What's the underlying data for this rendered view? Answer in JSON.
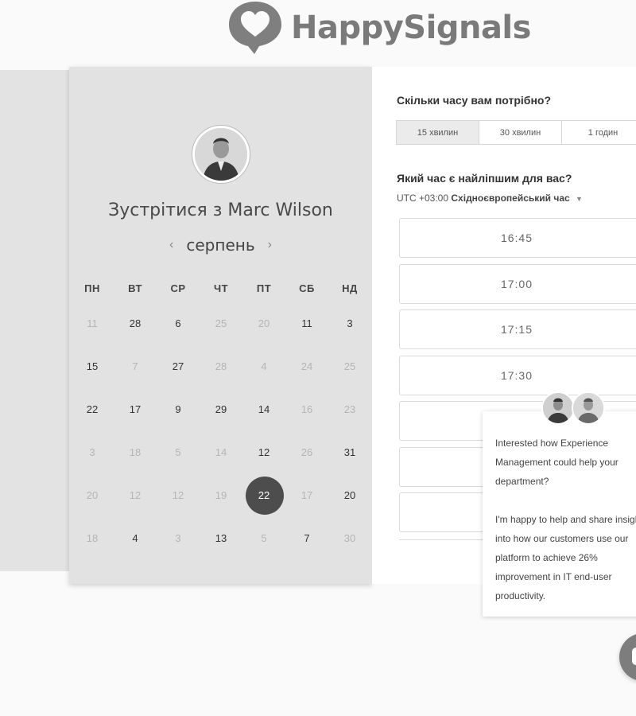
{
  "header": {
    "brand": "HappySignals",
    "colors": {
      "brand_grey": "#7a7a7a"
    }
  },
  "booking": {
    "host_title": "Зустрітися з Marc Wilson",
    "month": "серпень",
    "prev_icon": "chevron-left-icon",
    "next_icon": "chevron-right-icon",
    "weekdays": [
      "ПН",
      "ВТ",
      "СР",
      "ЧТ",
      "ПТ",
      "СБ",
      "НД"
    ],
    "weeks": [
      [
        {
          "d": "11",
          "m": true
        },
        {
          "d": "28",
          "m": false
        },
        {
          "d": "6",
          "m": false
        },
        {
          "d": "25",
          "m": true
        },
        {
          "d": "20",
          "m": true
        },
        {
          "d": "11",
          "m": false
        },
        {
          "d": "3",
          "m": false
        }
      ],
      [
        {
          "d": "15",
          "m": false
        },
        {
          "d": "7",
          "m": true
        },
        {
          "d": "27",
          "m": false
        },
        {
          "d": "28",
          "m": true
        },
        {
          "d": "4",
          "m": true
        },
        {
          "d": "24",
          "m": true
        },
        {
          "d": "25",
          "m": true
        }
      ],
      [
        {
          "d": "22",
          "m": false
        },
        {
          "d": "17",
          "m": false
        },
        {
          "d": "9",
          "m": false
        },
        {
          "d": "29",
          "m": false
        },
        {
          "d": "14",
          "m": false
        },
        {
          "d": "16",
          "m": true
        },
        {
          "d": "23",
          "m": true
        }
      ],
      [
        {
          "d": "3",
          "m": true
        },
        {
          "d": "18",
          "m": true
        },
        {
          "d": "5",
          "m": true
        },
        {
          "d": "14",
          "m": true
        },
        {
          "d": "12",
          "m": false
        },
        {
          "d": "26",
          "m": true
        },
        {
          "d": "31",
          "m": false
        }
      ],
      [
        {
          "d": "20",
          "m": true
        },
        {
          "d": "12",
          "m": true
        },
        {
          "d": "12",
          "m": true
        },
        {
          "d": "19",
          "m": true
        },
        {
          "d": "22",
          "m": false,
          "sel": true
        },
        {
          "d": "17",
          "m": true
        },
        {
          "d": "20",
          "m": false
        }
      ],
      [
        {
          "d": "18",
          "m": true
        },
        {
          "d": "4",
          "m": false
        },
        {
          "d": "3",
          "m": true
        },
        {
          "d": "13",
          "m": false
        },
        {
          "d": "5",
          "m": true
        },
        {
          "d": "7",
          "m": false
        },
        {
          "d": "30",
          "m": true
        }
      ]
    ]
  },
  "schedule": {
    "duration_question": "Скільки часу вам потрібно?",
    "durations": [
      "15 хвилин",
      "30 хвилин",
      "1 годин"
    ],
    "active_duration": "15 хвилин",
    "time_question": "Який час є найліпшим для вас?",
    "tz_offset": "UTC +03:00",
    "tz_name": "Східноєвропейський час",
    "slots": [
      "16:45",
      "17:00",
      "17:15",
      "17:30",
      "",
      "",
      ""
    ]
  },
  "chat": {
    "message": "Interested how Experience Management could help your department?",
    "message2": "I'm happy to help and share insight into how our customers use our platform to achieve 26% improvement in IT end-user productivity.",
    "launcher_icon": "chat-bubble-icon"
  }
}
